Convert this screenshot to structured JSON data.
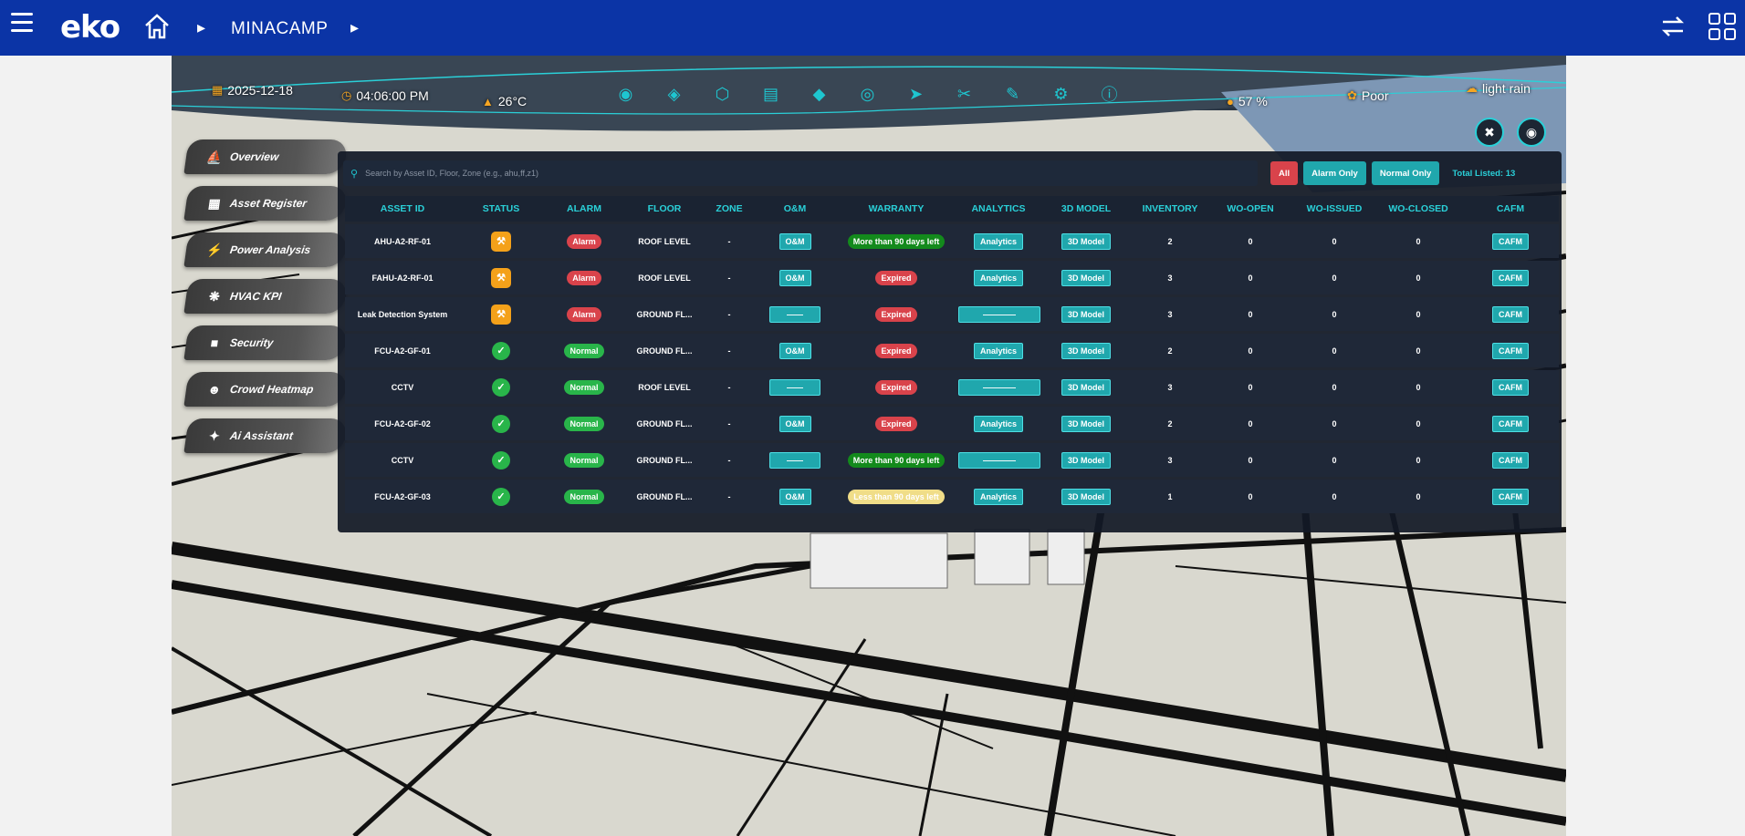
{
  "header": {
    "logo": "eko",
    "breadcrumb": "MINACAMP"
  },
  "hud": {
    "date": "2025-12-18",
    "time": "04:06:00 PM",
    "temperature": "26°C",
    "humidity": "57 %",
    "air_quality": "Poor",
    "weather": "light rain"
  },
  "sidebar": {
    "items": [
      {
        "label": "Overview",
        "icon": "ship-icon"
      },
      {
        "label": "Asset Register",
        "icon": "clipboard-icon"
      },
      {
        "label": "Power Analysis",
        "icon": "bolt-icon"
      },
      {
        "label": "HVAC KPI",
        "icon": "fan-icon"
      },
      {
        "label": "Security",
        "icon": "camera-icon"
      },
      {
        "label": "Crowd Heatmap",
        "icon": "people-icon"
      },
      {
        "label": "Ai Assistant",
        "icon": "sparkle-icon"
      }
    ]
  },
  "panel": {
    "search_placeholder": "Search by Asset ID, Floor, Zone (e.g., ahu,ff,z1)",
    "filters": {
      "all": "All",
      "alarm_only": "Alarm Only",
      "normal_only": "Normal Only"
    },
    "total": "Total Listed: 13",
    "columns": [
      "ASSET ID",
      "STATUS",
      "ALARM",
      "FLOOR",
      "ZONE",
      "O&M",
      "WARRANTY",
      "ANALYTICS",
      "3D MODEL",
      "INVENTORY",
      "WO-OPEN",
      "WO-ISSUED",
      "WO-CLOSED",
      "CAFM"
    ],
    "rows": [
      {
        "asset": "AHU-A2-RF-01",
        "status": "wrench",
        "alarm": "Alarm",
        "floor": "ROOF LEVEL",
        "zone": "-",
        "om": "O&M",
        "warranty": "More than 90 days left",
        "warranty_type": "green",
        "analytics": "Analytics",
        "model": "3D Model",
        "inventory": "2",
        "wo_open": "0",
        "wo_issued": "0",
        "wo_closed": "0",
        "cafm": "CAFM"
      },
      {
        "asset": "FAHU-A2-RF-01",
        "status": "wrench",
        "alarm": "Alarm",
        "floor": "ROOF LEVEL",
        "zone": "-",
        "om": "O&M",
        "warranty": "Expired",
        "warranty_type": "red",
        "analytics": "Analytics",
        "model": "3D Model",
        "inventory": "3",
        "wo_open": "0",
        "wo_issued": "0",
        "wo_closed": "0",
        "cafm": "CAFM"
      },
      {
        "asset": "Leak Detection System",
        "status": "wrench",
        "alarm": "Alarm",
        "floor": "GROUND FL...",
        "zone": "-",
        "om": "——",
        "warranty": "Expired",
        "warranty_type": "red",
        "analytics": "————",
        "model": "3D Model",
        "inventory": "3",
        "wo_open": "0",
        "wo_issued": "0",
        "wo_closed": "0",
        "cafm": "CAFM"
      },
      {
        "asset": "FCU-A2-GF-01",
        "status": "ok",
        "alarm": "Normal",
        "floor": "GROUND FL...",
        "zone": "-",
        "om": "O&M",
        "warranty": "Expired",
        "warranty_type": "red",
        "analytics": "Analytics",
        "model": "3D Model",
        "inventory": "2",
        "wo_open": "0",
        "wo_issued": "0",
        "wo_closed": "0",
        "cafm": "CAFM"
      },
      {
        "asset": "CCTV",
        "status": "ok",
        "alarm": "Normal",
        "floor": "ROOF LEVEL",
        "zone": "-",
        "om": "——",
        "warranty": "Expired",
        "warranty_type": "red",
        "analytics": "————",
        "model": "3D Model",
        "inventory": "3",
        "wo_open": "0",
        "wo_issued": "0",
        "wo_closed": "0",
        "cafm": "CAFM"
      },
      {
        "asset": "FCU-A2-GF-02",
        "status": "ok",
        "alarm": "Normal",
        "floor": "GROUND FL...",
        "zone": "-",
        "om": "O&M",
        "warranty": "Expired",
        "warranty_type": "red",
        "analytics": "Analytics",
        "model": "3D Model",
        "inventory": "2",
        "wo_open": "0",
        "wo_issued": "0",
        "wo_closed": "0",
        "cafm": "CAFM"
      },
      {
        "asset": "CCTV",
        "status": "ok",
        "alarm": "Normal",
        "floor": "GROUND FL...",
        "zone": "-",
        "om": "——",
        "warranty": "More than 90 days left",
        "warranty_type": "green",
        "analytics": "————",
        "model": "3D Model",
        "inventory": "3",
        "wo_open": "0",
        "wo_issued": "0",
        "wo_closed": "0",
        "cafm": "CAFM"
      },
      {
        "asset": "FCU-A2-GF-03",
        "status": "ok",
        "alarm": "Normal",
        "floor": "GROUND FL...",
        "zone": "-",
        "om": "O&M",
        "warranty": "Less than 90 days left",
        "warranty_type": "yellow",
        "analytics": "Analytics",
        "model": "3D Model",
        "inventory": "1",
        "wo_open": "0",
        "wo_issued": "0",
        "wo_closed": "0",
        "cafm": "CAFM"
      }
    ]
  },
  "colors": {
    "topbar": "#0b34a6",
    "accent": "#2ad0d8",
    "alarm": "#d9434b",
    "normal": "#29b54a",
    "warning": "#f4a11a"
  }
}
